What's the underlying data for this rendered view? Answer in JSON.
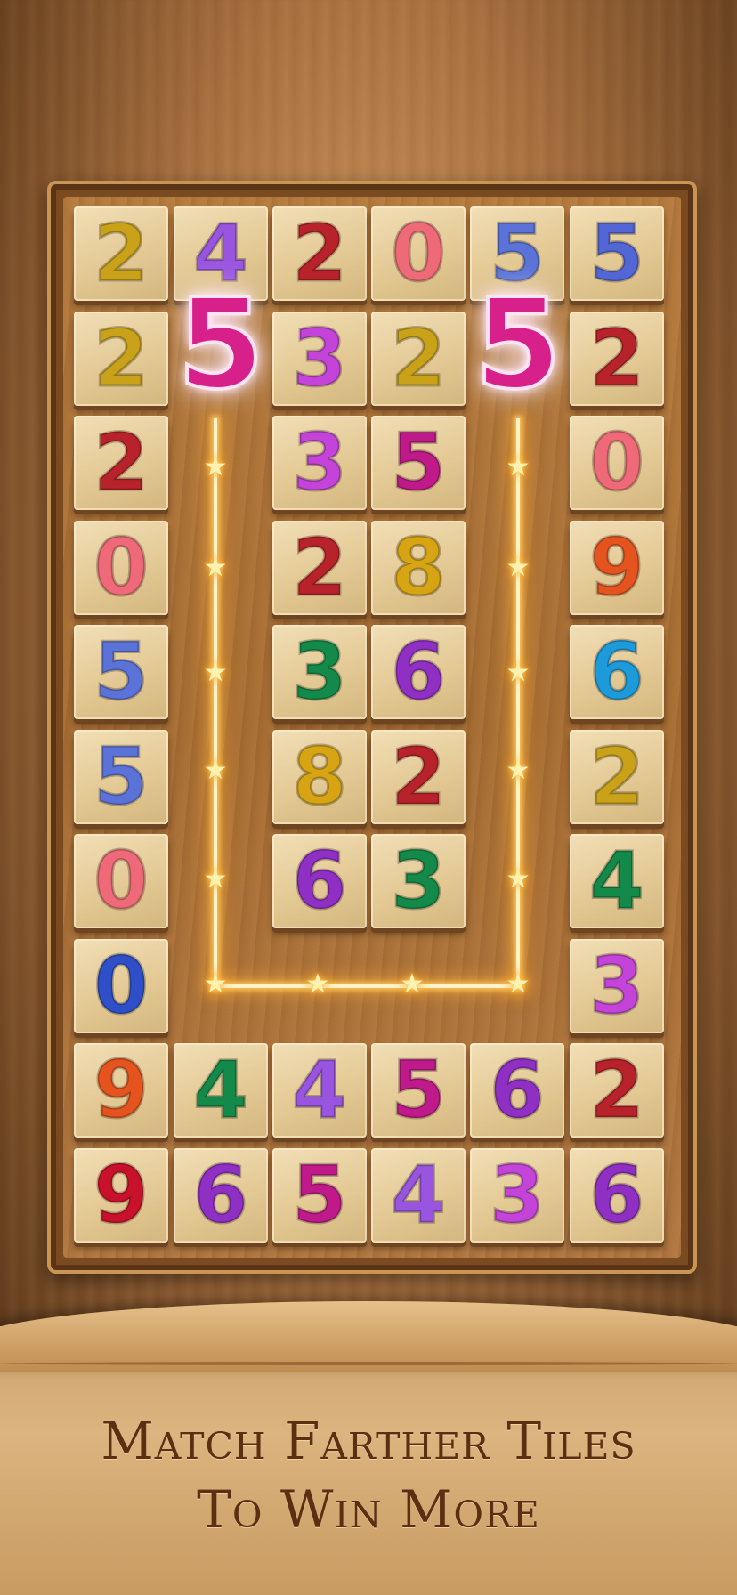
{
  "board": {
    "rows": [
      [
        {
          "d": "2",
          "c": "#c9a21a"
        },
        {
          "d": "4",
          "c": "#9a55e0"
        },
        {
          "d": "2",
          "c": "#b8222a"
        },
        {
          "d": "0",
          "c": "#ef6a78"
        },
        {
          "d": "5",
          "c": "#5b73d8"
        },
        {
          "d": "5",
          "c": "#5366d6"
        }
      ],
      [
        {
          "d": "2",
          "c": "#c9a21a"
        },
        null,
        {
          "d": "3",
          "c": "#c443d8"
        },
        {
          "d": "2",
          "c": "#c9a21a"
        },
        null,
        {
          "d": "2",
          "c": "#b8222a"
        }
      ],
      [
        {
          "d": "2",
          "c": "#b8222a"
        },
        null,
        {
          "d": "3",
          "c": "#c443d8"
        },
        {
          "d": "5",
          "c": "#c0198a"
        },
        null,
        {
          "d": "0",
          "c": "#ef6a78"
        }
      ],
      [
        {
          "d": "0",
          "c": "#ef6a78"
        },
        null,
        {
          "d": "2",
          "c": "#b8222a"
        },
        {
          "d": "8",
          "c": "#d7a514"
        },
        null,
        {
          "d": "9",
          "c": "#e5531f"
        }
      ],
      [
        {
          "d": "5",
          "c": "#5b73d8"
        },
        null,
        {
          "d": "3",
          "c": "#138a4a"
        },
        {
          "d": "6",
          "c": "#8f2fc4"
        },
        null,
        {
          "d": "6",
          "c": "#1d9ad9"
        }
      ],
      [
        {
          "d": "5",
          "c": "#5b73d8"
        },
        null,
        {
          "d": "8",
          "c": "#d7a514"
        },
        {
          "d": "2",
          "c": "#b8222a"
        },
        null,
        {
          "d": "2",
          "c": "#c9a21a"
        }
      ],
      [
        {
          "d": "0",
          "c": "#ef6a78"
        },
        null,
        {
          "d": "6",
          "c": "#8f2fc4"
        },
        {
          "d": "3",
          "c": "#138a4a"
        },
        null,
        {
          "d": "4",
          "c": "#138a4a"
        }
      ],
      [
        {
          "d": "0",
          "c": "#2f4fc8"
        },
        null,
        null,
        null,
        null,
        {
          "d": "3",
          "c": "#c443d8"
        }
      ],
      [
        {
          "d": "9",
          "c": "#e5531f"
        },
        {
          "d": "4",
          "c": "#138a4a"
        },
        {
          "d": "4",
          "c": "#9a55e0"
        },
        {
          "d": "5",
          "c": "#c0198a"
        },
        {
          "d": "6",
          "c": "#8f2fc4"
        },
        {
          "d": "2",
          "c": "#b8222a"
        }
      ],
      [
        {
          "d": "9",
          "c": "#c8122c"
        },
        {
          "d": "6",
          "c": "#8f2fc4"
        },
        {
          "d": "5",
          "c": "#c0198a"
        },
        {
          "d": "4",
          "c": "#9a55e0"
        },
        {
          "d": "3",
          "c": "#c443d8"
        },
        {
          "d": "6",
          "c": "#8f2fc4"
        }
      ]
    ]
  },
  "match": {
    "selected_left": "5",
    "selected_right": "5",
    "glow_color": "#d8208a"
  },
  "tagline": {
    "line1": "Match Farther Tiles",
    "line2": "To Win More"
  }
}
